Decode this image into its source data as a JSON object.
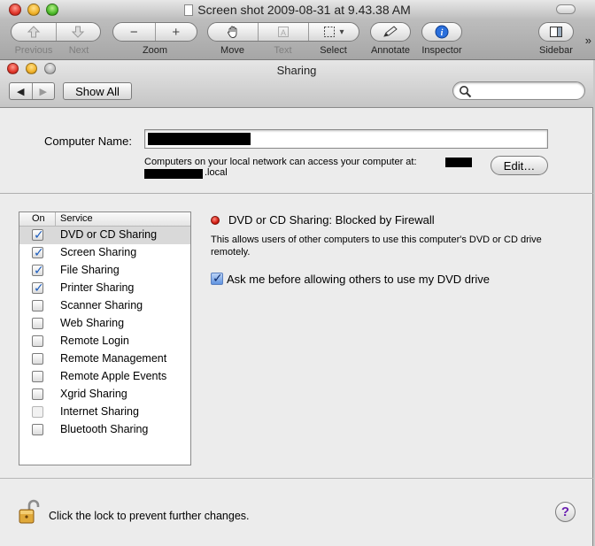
{
  "outer_window": {
    "title": "Screen shot 2009-08-31 at 9.43.38 AM",
    "toolbar": {
      "previous": "Previous",
      "next": "Next",
      "zoom": "Zoom",
      "move": "Move",
      "text": "Text",
      "select": "Select",
      "annotate": "Annotate",
      "inspector": "Inspector",
      "sidebar": "Sidebar",
      "zoom_out_glyph": "−",
      "zoom_in_glyph": "+",
      "select_dropdown_glyph": "▾",
      "overflow_glyph": "»"
    }
  },
  "sharing_window": {
    "title": "Sharing",
    "nav_back_glyph": "◀",
    "nav_forward_glyph": "▶",
    "show_all": "Show All",
    "search": {
      "value": "",
      "placeholder": ""
    },
    "computer_name_label": "Computer Name:",
    "computer_name_value": "",
    "info_line1": "Computers on your local network can access your computer at:",
    "info_line2": ".local",
    "edit_button": "Edit…",
    "list_header": {
      "on": "On",
      "service": "Service"
    },
    "services": [
      {
        "name": "DVD or CD Sharing",
        "checked": true,
        "selected": true
      },
      {
        "name": "Screen Sharing",
        "checked": true
      },
      {
        "name": "File Sharing",
        "checked": true
      },
      {
        "name": "Printer Sharing",
        "checked": true
      },
      {
        "name": "Scanner Sharing",
        "checked": false
      },
      {
        "name": "Web Sharing",
        "checked": false
      },
      {
        "name": "Remote Login",
        "checked": false
      },
      {
        "name": "Remote Management",
        "checked": false
      },
      {
        "name": "Remote Apple Events",
        "checked": false
      },
      {
        "name": "Xgrid Sharing",
        "checked": false
      },
      {
        "name": "Internet Sharing",
        "checked": false,
        "disabled": true
      },
      {
        "name": "Bluetooth Sharing",
        "checked": false
      }
    ],
    "status_text": "DVD or CD Sharing: Blocked by Firewall",
    "status_color": "#d01b10",
    "description": "This allows users of other computers to use this computer's DVD or CD drive remotely.",
    "ask_checkbox_label": "Ask me before allowing others to use my DVD drive",
    "ask_checkbox_checked": true,
    "lock_text": "Click the lock to prevent further changes.",
    "help_glyph": "?",
    "check_glyph": "✓"
  },
  "colors": {
    "accent": "#1a5bbd",
    "help": "#6a1fb0"
  }
}
